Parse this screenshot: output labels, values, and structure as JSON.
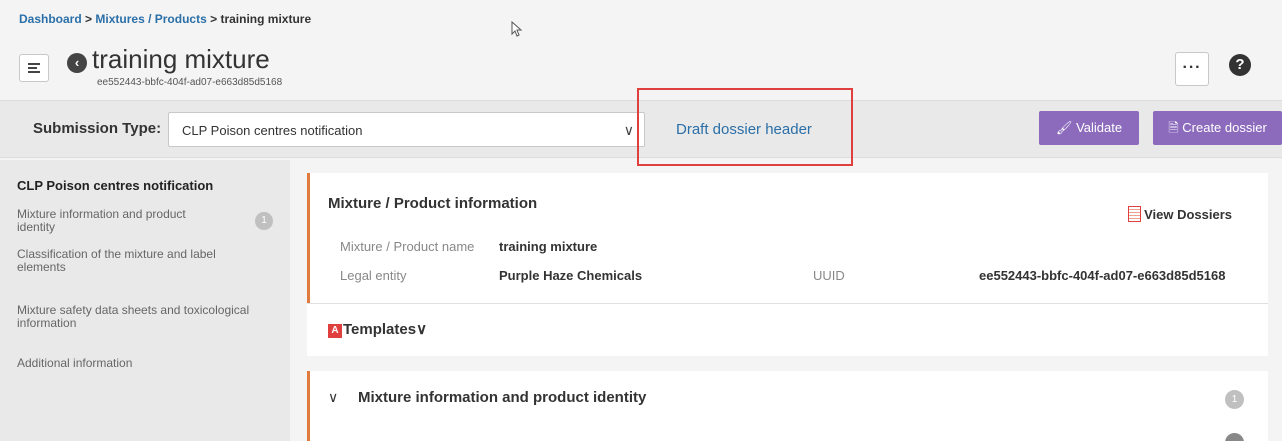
{
  "breadcrumb": {
    "dashboard": "Dashboard",
    "sep": ">",
    "mixtures": "Mixtures / Products",
    "current": "training mixture"
  },
  "header": {
    "title": "training mixture",
    "uuid": "ee552443-bbfc-404f-ad07-e663d85d5168",
    "more_label": "···",
    "help_label": "?"
  },
  "submission": {
    "label": "Submission Type:",
    "selected": "CLP Poison centres notification",
    "draft_link": "Draft dossier header",
    "validate_label": "Validate",
    "create_label": "Create dossier"
  },
  "sidebar": {
    "title": "CLP Poison centres notification",
    "items": [
      {
        "label": "Mixture information and product identity",
        "badge": "1"
      },
      {
        "label": "Classification of the mixture and label elements"
      },
      {
        "label": "Mixture safety data sheets and toxicological information"
      },
      {
        "label": "Additional information"
      }
    ]
  },
  "product_info": {
    "title": "Mixture / Product information",
    "view_dossiers": "View Dossiers",
    "name_label": "Mixture / Product name",
    "name_value": "training mixture",
    "legal_label": "Legal entity",
    "legal_value": "Purple Haze Chemicals",
    "uuid_label": "UUID",
    "uuid_value": "ee552443-bbfc-404f-ad07-e663d85d5168"
  },
  "templates": {
    "label": "Templates",
    "chevron": "∨"
  },
  "section": {
    "title": "Mixture information and product identity",
    "badge": "1"
  },
  "colors": {
    "accent_purple": "#8c6bbd",
    "link_blue": "#2a6fa8",
    "accent_orange": "#e07a3e",
    "highlight_red": "#e0403d"
  }
}
